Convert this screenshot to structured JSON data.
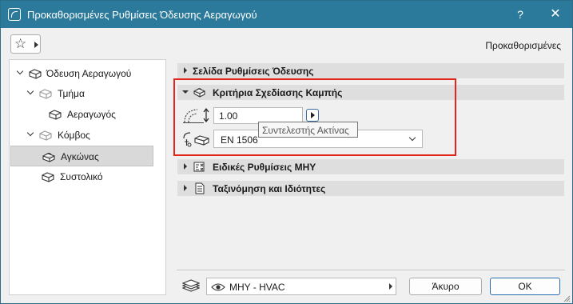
{
  "window": {
    "title": "Προκαθορισμένες Ρυθμίσεις Όδευσης Αεραγωγού",
    "help_label": "?",
    "close_label": "✕"
  },
  "toolbar": {
    "favorites_icon": "star-icon",
    "preset_label": "Προκαθορισμένες"
  },
  "tree": {
    "items": [
      {
        "label": "Όδευση Αεραγωγού",
        "icon": "duct-route-icon",
        "expanded": true
      },
      {
        "label": "Τμήμα",
        "icon": "segment-icon",
        "expanded": true
      },
      {
        "label": "Αεραγωγός",
        "icon": "duct-icon"
      },
      {
        "label": "Κόμβος",
        "icon": "node-icon",
        "expanded": true
      },
      {
        "label": "Αγκώνας",
        "icon": "elbow-icon",
        "selected": true
      },
      {
        "label": "Συστολικό",
        "icon": "transition-icon"
      }
    ]
  },
  "sections": [
    {
      "label": "Σελίδα Ρυθμίσεις Όδευσης",
      "expanded": false
    },
    {
      "label": "Κριτήρια Σχεδίασης Καμπής",
      "expanded": true,
      "icon": "bend-icon"
    },
    {
      "label": "Ειδικές Ρυθμίσεις ΜΗΥ",
      "expanded": false,
      "icon": "mep-settings-icon"
    },
    {
      "label": "Ταξινόμηση και Ιδιότητες",
      "expanded": false,
      "icon": "classification-icon"
    }
  ],
  "bend": {
    "radius_value": "1.00",
    "radius_tooltip": "Συντελεστής Ακτίνας",
    "standard_value": "EN 1506"
  },
  "footer": {
    "layer_label": "ΜΗΥ - HVAC",
    "cancel_label": "Άκυρο",
    "ok_label": "OK"
  },
  "colors": {
    "titlebar": "#2b7a9b",
    "highlight": "#e3261b"
  }
}
